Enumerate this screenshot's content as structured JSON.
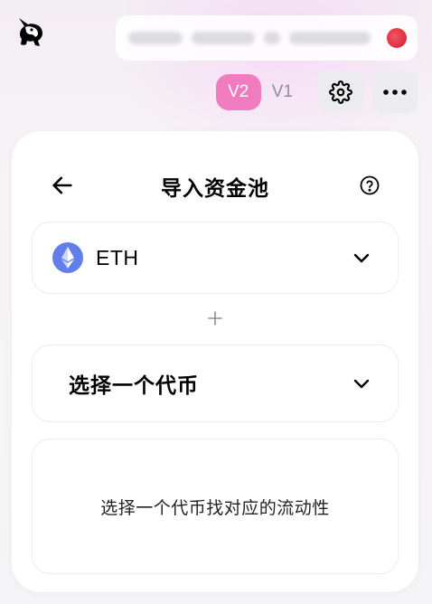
{
  "header": {
    "account": {
      "address": ""
    },
    "versions": [
      {
        "label": "V2",
        "active": true
      },
      {
        "label": "V1",
        "active": false
      }
    ],
    "icons": {
      "logo": "uniswap-unicorn-icon",
      "settings": "gear-icon",
      "more": "more-dots-icon"
    }
  },
  "card": {
    "title": "导入资金池",
    "back_icon": "arrow-left-icon",
    "help_icon": "question-circle-icon",
    "token_a": {
      "symbol": "ETH",
      "icon": "ethereum-icon"
    },
    "separator_icon": "plus-icon",
    "token_b": {
      "placeholder": "选择一个代币"
    },
    "info_message": "选择一个代币找对应的流动性"
  },
  "colors": {
    "accent_pink": "#f07cbf",
    "status_red": "#e0323f",
    "eth_blue": "#627eea",
    "border": "#ededf0"
  }
}
